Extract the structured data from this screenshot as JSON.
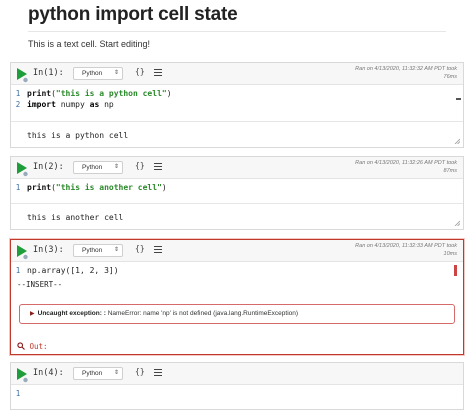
{
  "notebook": {
    "title": "python import cell state",
    "text_cell": "This is a text cell. Start editing!"
  },
  "colors": {
    "run_green": "#1e9e3a",
    "error_red": "#c0392b",
    "string_green": "#2a8a2a",
    "line_number_blue": "#3a6ea5"
  },
  "cells": [
    {
      "prompt": "In(1):",
      "kernel": "Python",
      "braces": "{}",
      "run_info_line1": "Ran on 4/13/2020, 11:32:32 AM PDT took",
      "run_info_line2": "76ms",
      "code": [
        {
          "n": "1",
          "kw": "print",
          "rest_open": "(",
          "str": "\"this is a python cell\"",
          "rest_close": ")"
        },
        {
          "n": "2",
          "kw": "import",
          "rest": " numpy ",
          "kw2": "as",
          "rest2": " np"
        }
      ],
      "output": "this is a python cell"
    },
    {
      "prompt": "In(2):",
      "kernel": "Python",
      "braces": "{}",
      "run_info_line1": "Ran on 4/13/2020, 11:32:26 AM PDT took",
      "run_info_line2": "87ms",
      "code": [
        {
          "n": "1",
          "kw": "print",
          "rest_open": "(",
          "str": "\"this is another cell\"",
          "rest_close": ")"
        }
      ],
      "output": "this is another cell"
    },
    {
      "prompt": "In(3):",
      "kernel": "Python",
      "braces": "{}",
      "run_info_line1": "Ran on 4/13/2020, 11:32:33 AM PDT took",
      "run_info_line2": "10ms",
      "code": [
        {
          "n": "1",
          "text": "np.array([1, 2, 3])"
        }
      ],
      "mode": "--INSERT--",
      "error_label": "Uncaught exception: :",
      "error_message": "NameError: name 'np' is not defined (java.lang.RuntimeException)",
      "out_label": "Out:"
    },
    {
      "prompt": "In(4):",
      "kernel": "Python",
      "braces": "{}",
      "code": [
        {
          "n": "1",
          "text": ""
        }
      ]
    }
  ]
}
